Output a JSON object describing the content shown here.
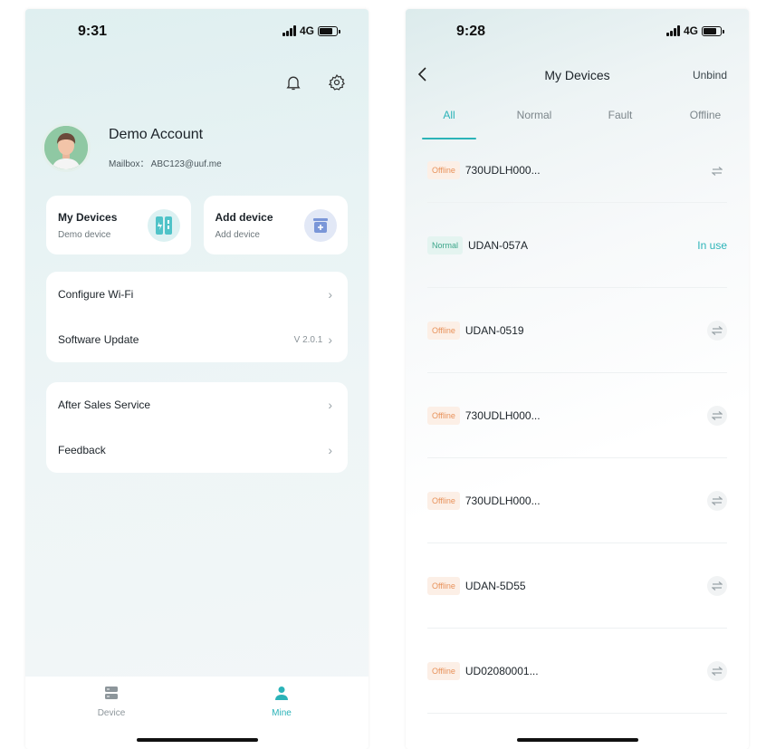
{
  "left_screen": {
    "status": {
      "time": "9:31",
      "network": "4G"
    },
    "profile": {
      "name": "Demo Account",
      "mailbox": "Mailbox： ABC123@uuf.me"
    },
    "quick_cards": [
      {
        "title": "My Devices",
        "subtitle": "Demo device",
        "icon": "device-icon",
        "color": "#4fc3c8"
      },
      {
        "title": "Add device",
        "subtitle": "Add device",
        "icon": "add-box-icon",
        "color": "#7a96d8"
      }
    ],
    "menu_group1": [
      {
        "label": "Configure Wi-Fi",
        "value": ""
      },
      {
        "label": "Software Update",
        "value": "V 2.0.1"
      }
    ],
    "menu_group2": [
      {
        "label": "After Sales Service",
        "value": ""
      },
      {
        "label": "Feedback",
        "value": ""
      }
    ],
    "tabbar": [
      {
        "label": "Device",
        "icon": "server-icon",
        "active": false
      },
      {
        "label": "Mine",
        "icon": "person-icon",
        "active": true
      }
    ]
  },
  "right_screen": {
    "status": {
      "time": "9:28",
      "network": "4G"
    },
    "nav": {
      "title": "My Devices",
      "action": "Unbind"
    },
    "tabs": [
      "All",
      "Normal",
      "Fault",
      "Offline"
    ],
    "active_tab": "All",
    "devices": [
      {
        "status": "Offline",
        "name": "730UDLH000...",
        "action": "swap"
      },
      {
        "status": "Normal",
        "name": "UDAN-057A",
        "action": "In use"
      },
      {
        "status": "Offline",
        "name": "UDAN-0519",
        "action": "swap"
      },
      {
        "status": "Offline",
        "name": "730UDLH000...",
        "action": "swap"
      },
      {
        "status": "Offline",
        "name": "730UDLH000...",
        "action": "swap"
      },
      {
        "status": "Offline",
        "name": "UDAN-5D55",
        "action": "swap"
      },
      {
        "status": "Offline",
        "name": "UD02080001...",
        "action": "swap"
      }
    ]
  },
  "colors": {
    "accent": "#2bb3b8",
    "offline": "#e8925b",
    "normal": "#3aa589"
  }
}
